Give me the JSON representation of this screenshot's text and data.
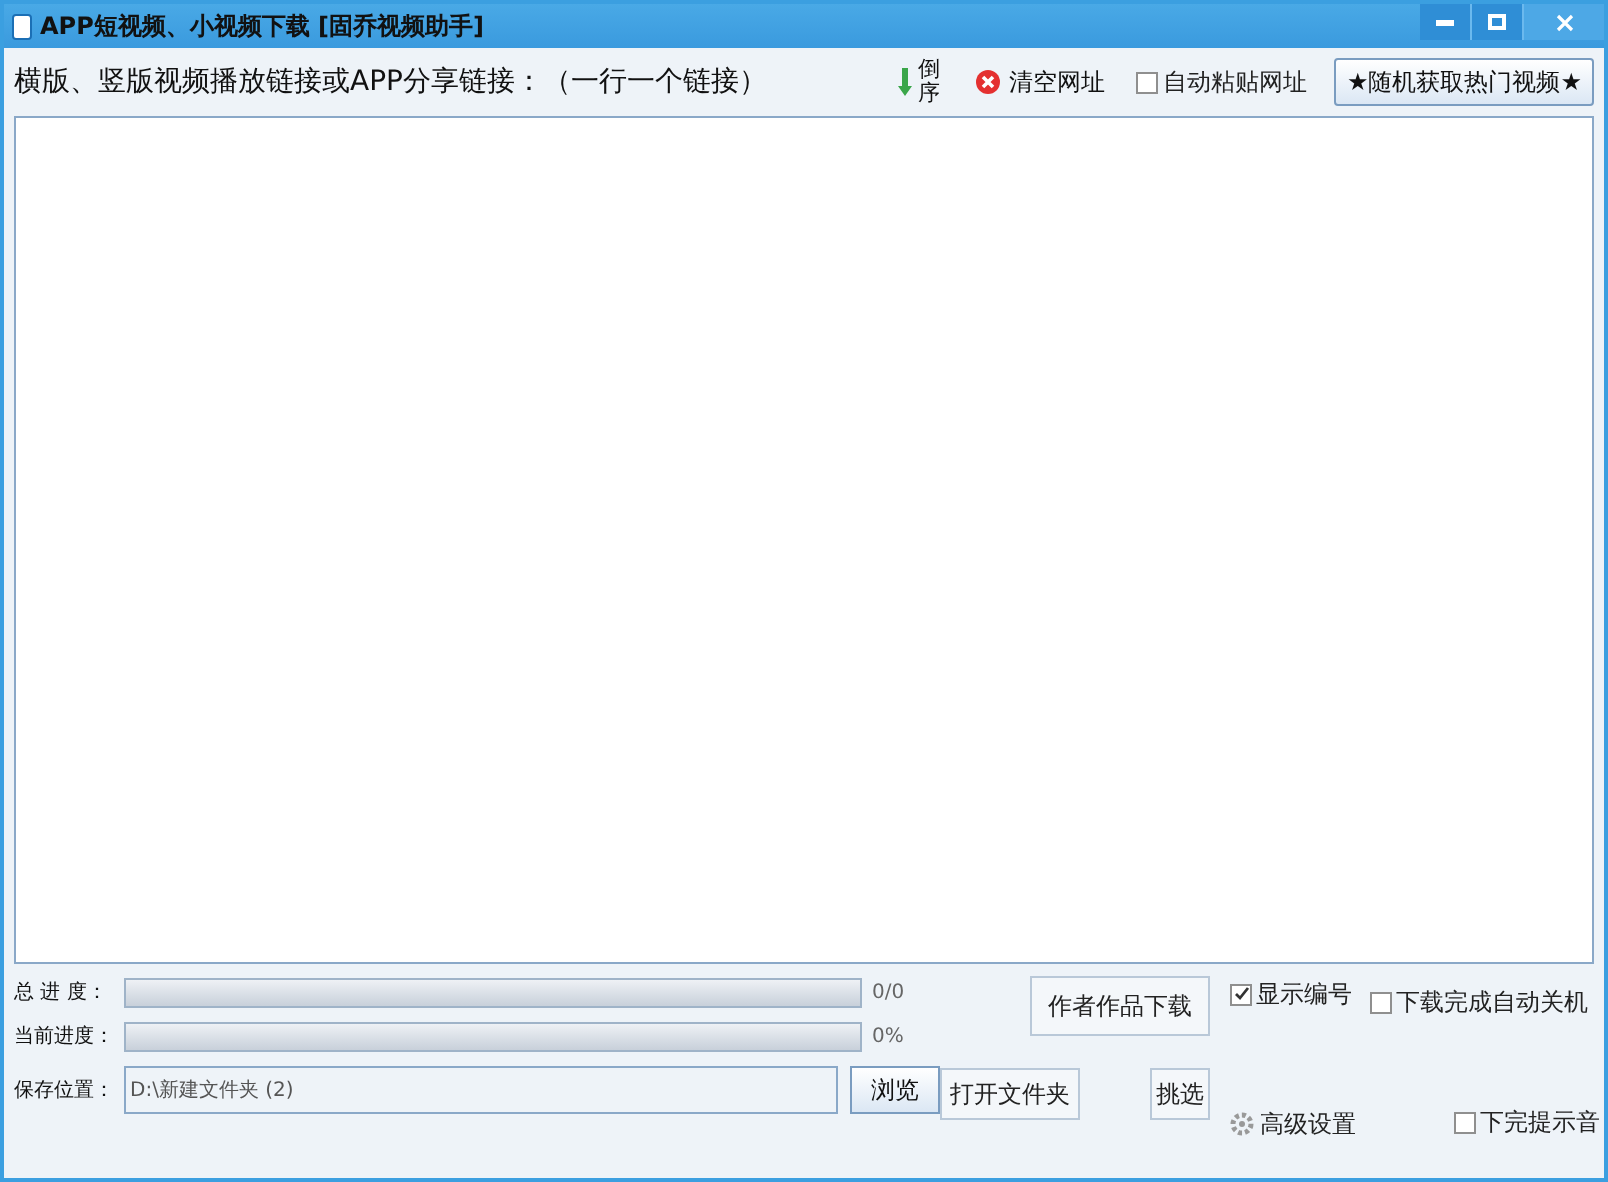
{
  "window": {
    "title": "APP短视频、小视频下载 [固乔视频助手]"
  },
  "toolbar": {
    "prompt": "横版、竖版视频播放链接或APP分享链接：（一行一个链接）",
    "reverse": "倒序",
    "clear": "清空网址",
    "auto_paste": {
      "label": "自动粘贴网址",
      "checked": false
    },
    "random_button": "★随机获取热门视频★"
  },
  "progress": [
    {
      "label": "总 进 度：",
      "level": 0,
      "reading": "0/0"
    },
    {
      "label": "当前进度：",
      "level": 0,
      "reading": "0%"
    }
  ],
  "save": {
    "label": "保存位置：",
    "value": "D:\\新建文件夹 (2)",
    "button": "浏览"
  },
  "actions": {
    "author_button": "作者作品下载",
    "open_folder": "打开文件夹",
    "pick": "挑选",
    "advanced": "高级设置"
  },
  "options": [
    {
      "label": "显示编号",
      "checked": true
    },
    {
      "label": "下载完成自动关机",
      "checked": false
    },
    {
      "label": "下完提示音",
      "checked": false
    }
  ]
}
